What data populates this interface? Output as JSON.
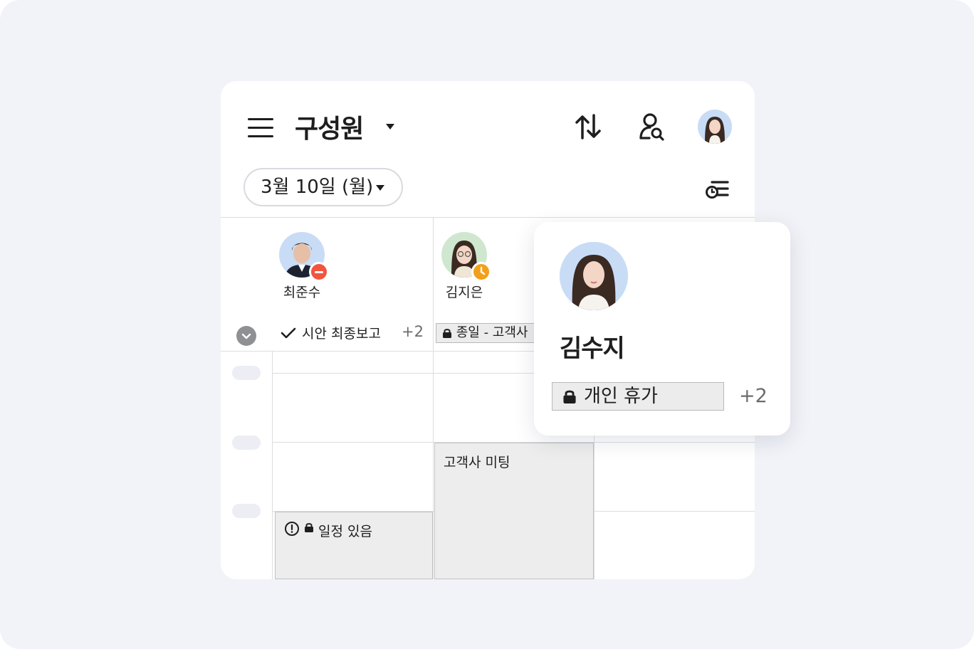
{
  "header": {
    "title": "구성원",
    "icons": [
      "menu-icon",
      "sort-icon",
      "member-search-icon",
      "my-avatar"
    ]
  },
  "date_selector": {
    "label": "3월 10일 (월)"
  },
  "members": [
    {
      "name": "최준수",
      "status": "busy",
      "status_color": "#f2543d"
    },
    {
      "name": "김지은",
      "status": "away",
      "status_color": "#f2a01c"
    }
  ],
  "all_day": {
    "task_label": "시안 최종보고",
    "task_more": "+2",
    "chip_label": "종일 - 고객사"
  },
  "events": [
    {
      "label": "고객사 미팅"
    },
    {
      "label": "일정 있음"
    }
  ],
  "popover": {
    "name": "김수지",
    "chip_label": "개인 휴가",
    "more": "+2"
  },
  "colors": {
    "background": "#f1f3f8",
    "event_fill": "#ededed",
    "busy": "#f2543d",
    "away": "#f2a01c"
  }
}
